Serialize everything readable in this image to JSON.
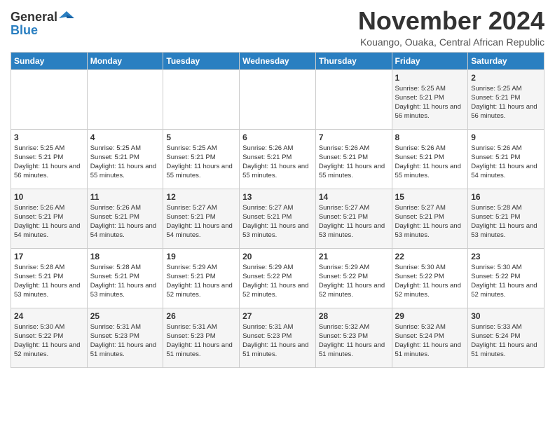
{
  "header": {
    "logo_general": "General",
    "logo_blue": "Blue",
    "month_title": "November 2024",
    "subtitle": "Kouango, Ouaka, Central African Republic"
  },
  "days_of_week": [
    "Sunday",
    "Monday",
    "Tuesday",
    "Wednesday",
    "Thursday",
    "Friday",
    "Saturday"
  ],
  "weeks": [
    [
      {
        "day": "",
        "info": ""
      },
      {
        "day": "",
        "info": ""
      },
      {
        "day": "",
        "info": ""
      },
      {
        "day": "",
        "info": ""
      },
      {
        "day": "",
        "info": ""
      },
      {
        "day": "1",
        "info": "Sunrise: 5:25 AM\nSunset: 5:21 PM\nDaylight: 11 hours and 56 minutes."
      },
      {
        "day": "2",
        "info": "Sunrise: 5:25 AM\nSunset: 5:21 PM\nDaylight: 11 hours and 56 minutes."
      }
    ],
    [
      {
        "day": "3",
        "info": "Sunrise: 5:25 AM\nSunset: 5:21 PM\nDaylight: 11 hours and 56 minutes."
      },
      {
        "day": "4",
        "info": "Sunrise: 5:25 AM\nSunset: 5:21 PM\nDaylight: 11 hours and 55 minutes."
      },
      {
        "day": "5",
        "info": "Sunrise: 5:25 AM\nSunset: 5:21 PM\nDaylight: 11 hours and 55 minutes."
      },
      {
        "day": "6",
        "info": "Sunrise: 5:26 AM\nSunset: 5:21 PM\nDaylight: 11 hours and 55 minutes."
      },
      {
        "day": "7",
        "info": "Sunrise: 5:26 AM\nSunset: 5:21 PM\nDaylight: 11 hours and 55 minutes."
      },
      {
        "day": "8",
        "info": "Sunrise: 5:26 AM\nSunset: 5:21 PM\nDaylight: 11 hours and 55 minutes."
      },
      {
        "day": "9",
        "info": "Sunrise: 5:26 AM\nSunset: 5:21 PM\nDaylight: 11 hours and 54 minutes."
      }
    ],
    [
      {
        "day": "10",
        "info": "Sunrise: 5:26 AM\nSunset: 5:21 PM\nDaylight: 11 hours and 54 minutes."
      },
      {
        "day": "11",
        "info": "Sunrise: 5:26 AM\nSunset: 5:21 PM\nDaylight: 11 hours and 54 minutes."
      },
      {
        "day": "12",
        "info": "Sunrise: 5:27 AM\nSunset: 5:21 PM\nDaylight: 11 hours and 54 minutes."
      },
      {
        "day": "13",
        "info": "Sunrise: 5:27 AM\nSunset: 5:21 PM\nDaylight: 11 hours and 53 minutes."
      },
      {
        "day": "14",
        "info": "Sunrise: 5:27 AM\nSunset: 5:21 PM\nDaylight: 11 hours and 53 minutes."
      },
      {
        "day": "15",
        "info": "Sunrise: 5:27 AM\nSunset: 5:21 PM\nDaylight: 11 hours and 53 minutes."
      },
      {
        "day": "16",
        "info": "Sunrise: 5:28 AM\nSunset: 5:21 PM\nDaylight: 11 hours and 53 minutes."
      }
    ],
    [
      {
        "day": "17",
        "info": "Sunrise: 5:28 AM\nSunset: 5:21 PM\nDaylight: 11 hours and 53 minutes."
      },
      {
        "day": "18",
        "info": "Sunrise: 5:28 AM\nSunset: 5:21 PM\nDaylight: 11 hours and 53 minutes."
      },
      {
        "day": "19",
        "info": "Sunrise: 5:29 AM\nSunset: 5:21 PM\nDaylight: 11 hours and 52 minutes."
      },
      {
        "day": "20",
        "info": "Sunrise: 5:29 AM\nSunset: 5:22 PM\nDaylight: 11 hours and 52 minutes."
      },
      {
        "day": "21",
        "info": "Sunrise: 5:29 AM\nSunset: 5:22 PM\nDaylight: 11 hours and 52 minutes."
      },
      {
        "day": "22",
        "info": "Sunrise: 5:30 AM\nSunset: 5:22 PM\nDaylight: 11 hours and 52 minutes."
      },
      {
        "day": "23",
        "info": "Sunrise: 5:30 AM\nSunset: 5:22 PM\nDaylight: 11 hours and 52 minutes."
      }
    ],
    [
      {
        "day": "24",
        "info": "Sunrise: 5:30 AM\nSunset: 5:22 PM\nDaylight: 11 hours and 52 minutes."
      },
      {
        "day": "25",
        "info": "Sunrise: 5:31 AM\nSunset: 5:23 PM\nDaylight: 11 hours and 51 minutes."
      },
      {
        "day": "26",
        "info": "Sunrise: 5:31 AM\nSunset: 5:23 PM\nDaylight: 11 hours and 51 minutes."
      },
      {
        "day": "27",
        "info": "Sunrise: 5:31 AM\nSunset: 5:23 PM\nDaylight: 11 hours and 51 minutes."
      },
      {
        "day": "28",
        "info": "Sunrise: 5:32 AM\nSunset: 5:23 PM\nDaylight: 11 hours and 51 minutes."
      },
      {
        "day": "29",
        "info": "Sunrise: 5:32 AM\nSunset: 5:24 PM\nDaylight: 11 hours and 51 minutes."
      },
      {
        "day": "30",
        "info": "Sunrise: 5:33 AM\nSunset: 5:24 PM\nDaylight: 11 hours and 51 minutes."
      }
    ]
  ]
}
